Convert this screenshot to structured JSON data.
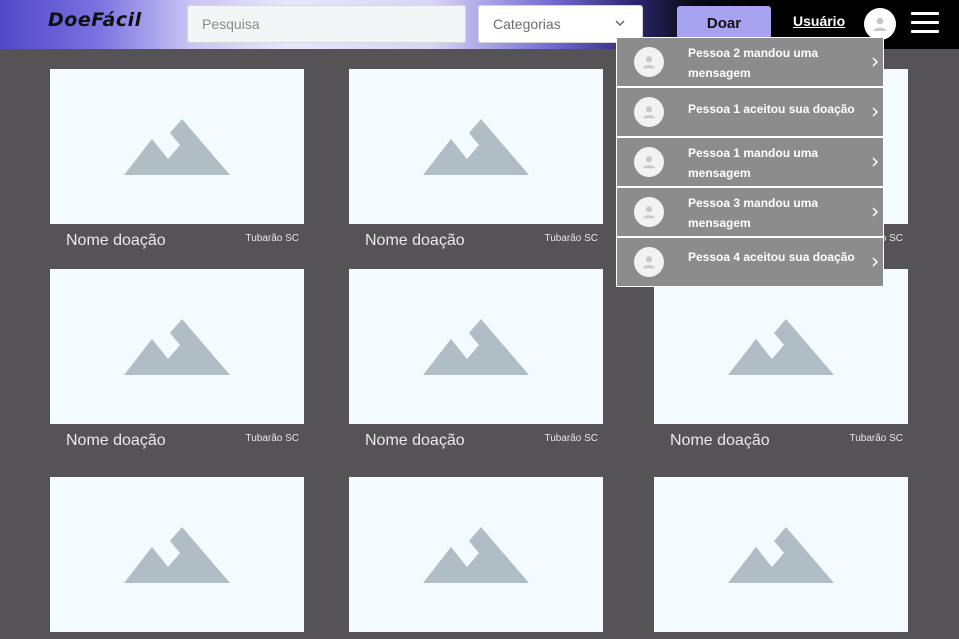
{
  "header": {
    "logo": "DoeFácil",
    "search_placeholder": "Pesquisa",
    "categories_label": "Categorias",
    "donate_label": "Doar",
    "user_label": "Usuário"
  },
  "cards": [
    {
      "title": "Nome doação",
      "location": "Tubarão SC"
    },
    {
      "title": "Nome doação",
      "location": "Tubarão SC"
    },
    {
      "title": "Nome doação",
      "location": "Tubarão SC"
    },
    {
      "title": "Nome doação",
      "location": "Tubarão SC"
    },
    {
      "title": "Nome doação",
      "location": "Tubarão SC"
    },
    {
      "title": "Nome doação",
      "location": "Tubarão SC"
    },
    {
      "title": "",
      "location": ""
    },
    {
      "title": "",
      "location": ""
    },
    {
      "title": "",
      "location": ""
    }
  ],
  "notifications": [
    {
      "text": "Pessoa 2 mandou uma mensagem"
    },
    {
      "text": "Pessoa 1 aceitou sua doação"
    },
    {
      "text": "Pessoa 1 mandou uma mensagem"
    },
    {
      "text": "Pessoa 3 mandou uma mensagem"
    },
    {
      "text": "Pessoa 4 aceitou sua doação"
    }
  ]
}
